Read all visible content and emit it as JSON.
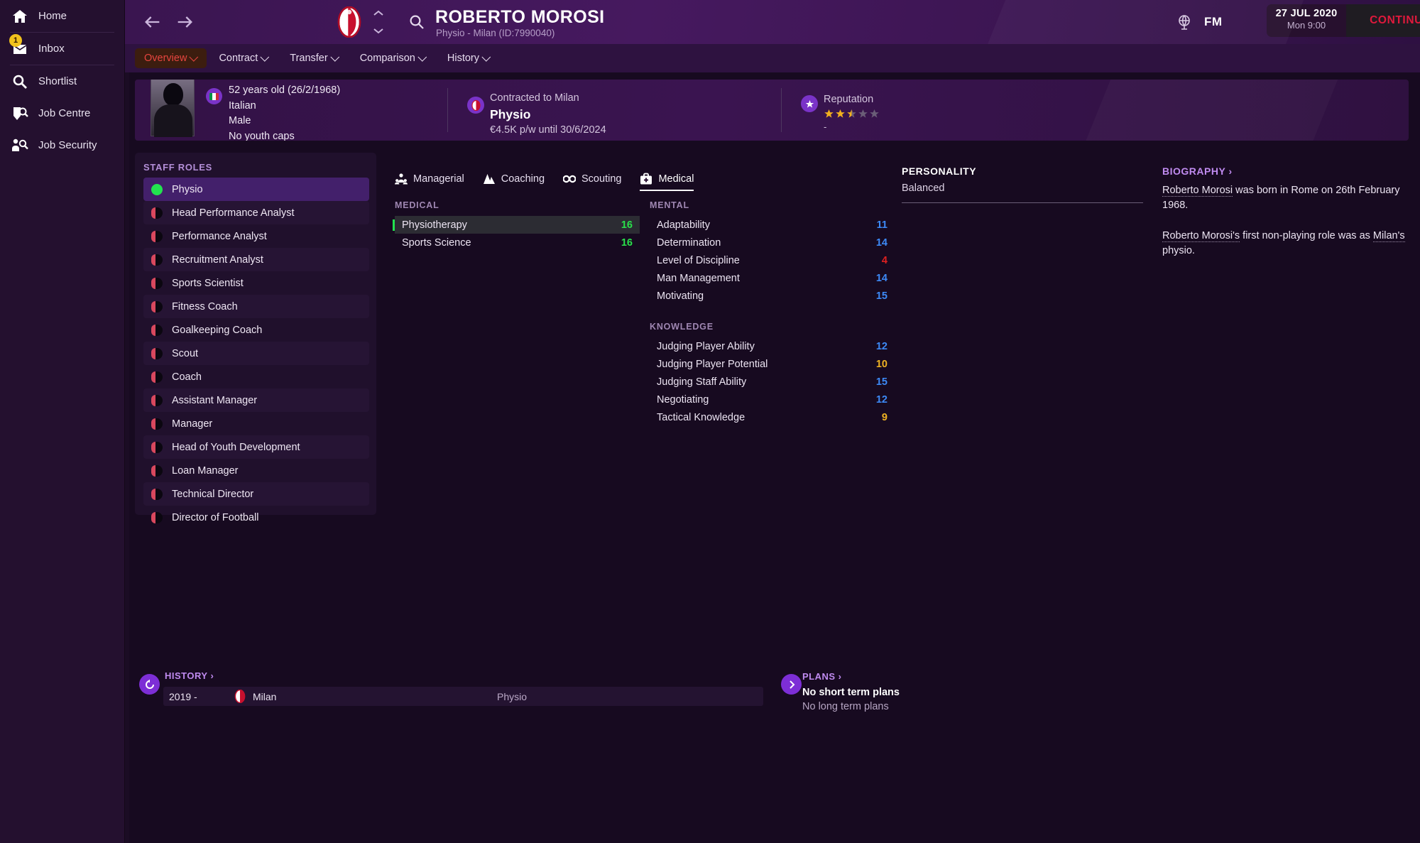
{
  "nav": {
    "items": [
      {
        "label": "Home",
        "icon": "home-icon",
        "badge": null
      },
      {
        "label": "Inbox",
        "icon": "inbox-icon",
        "badge": "1"
      },
      {
        "label": "Shortlist",
        "icon": "search-icon",
        "badge": null
      },
      {
        "label": "Job Centre",
        "icon": "job-centre-icon",
        "badge": null
      },
      {
        "label": "Job Security",
        "icon": "job-security-icon",
        "badge": null
      }
    ]
  },
  "topbar": {
    "back_icon": "back-arrow-icon",
    "forward_icon": "forward-arrow-icon",
    "club_crest": "ac-milan-crest-icon",
    "search_icon": "magnifier-icon",
    "person_name": "ROBERTO MOROSI",
    "person_sub": "Physio - Milan (ID:7990040)",
    "globe_icon": "globe-icon",
    "fm_logo": "FM",
    "date": "27 JUL 2020",
    "time": "Mon 9:00",
    "continue_label": "CONTINUE"
  },
  "submenu": {
    "items": [
      {
        "label": "Overview",
        "active": true
      },
      {
        "label": "Contract",
        "active": false
      },
      {
        "label": "Transfer",
        "active": false
      },
      {
        "label": "Comparison",
        "active": false
      },
      {
        "label": "History",
        "active": false
      }
    ]
  },
  "info": {
    "age": "52 years old (26/2/1968)",
    "nationality": "Italian",
    "gender": "Male",
    "caps": "No youth caps",
    "contract_label": "Contracted to Milan",
    "role": "Physio",
    "wage": "€4.5K p/w until 30/6/2024",
    "reputation_label": "Reputation",
    "reputation_stars": 2.5,
    "reputation_value": "-"
  },
  "staff_roles": {
    "title": "STAFF ROLES",
    "items": [
      {
        "label": "Physio",
        "selected": true,
        "status": "green"
      },
      {
        "label": "Head Performance Analyst",
        "selected": false,
        "status": "none"
      },
      {
        "label": "Performance Analyst",
        "selected": false,
        "status": "none"
      },
      {
        "label": "Recruitment Analyst",
        "selected": false,
        "status": "none"
      },
      {
        "label": "Sports Scientist",
        "selected": false,
        "status": "none"
      },
      {
        "label": "Fitness Coach",
        "selected": false,
        "status": "none"
      },
      {
        "label": "Goalkeeping Coach",
        "selected": false,
        "status": "none"
      },
      {
        "label": "Scout",
        "selected": false,
        "status": "none"
      },
      {
        "label": "Coach",
        "selected": false,
        "status": "none"
      },
      {
        "label": "Assistant Manager",
        "selected": false,
        "status": "none"
      },
      {
        "label": "Manager",
        "selected": false,
        "status": "none"
      },
      {
        "label": "Head of Youth Development",
        "selected": false,
        "status": "none"
      },
      {
        "label": "Loan Manager",
        "selected": false,
        "status": "none"
      },
      {
        "label": "Technical Director",
        "selected": false,
        "status": "none"
      },
      {
        "label": "Director of Football",
        "selected": false,
        "status": "none"
      }
    ]
  },
  "attribute_tabs": [
    {
      "label": "Managerial",
      "icon": "person-group-icon",
      "active": false
    },
    {
      "label": "Coaching",
      "icon": "whistle-cone-icon",
      "active": false
    },
    {
      "label": "Scouting",
      "icon": "binoculars-icon",
      "active": false
    },
    {
      "label": "Medical",
      "icon": "medical-bag-icon",
      "active": true
    }
  ],
  "attributes": {
    "medical": {
      "title": "MEDICAL",
      "rows": [
        {
          "name": "Physiotherapy",
          "value": "16",
          "color": "#29e04a",
          "highlight": true
        },
        {
          "name": "Sports Science",
          "value": "16",
          "color": "#29e04a",
          "highlight": false
        }
      ]
    },
    "mental": {
      "title": "MENTAL",
      "rows": [
        {
          "name": "Adaptability",
          "value": "11",
          "color": "#3d8af7"
        },
        {
          "name": "Determination",
          "value": "14",
          "color": "#3d8af7"
        },
        {
          "name": "Level of Discipline",
          "value": "4",
          "color": "#e02020"
        },
        {
          "name": "Man Management",
          "value": "14",
          "color": "#3d8af7"
        },
        {
          "name": "Motivating",
          "value": "15",
          "color": "#3d8af7"
        }
      ]
    },
    "knowledge": {
      "title": "KNOWLEDGE",
      "rows": [
        {
          "name": "Judging Player Ability",
          "value": "12",
          "color": "#3d8af7"
        },
        {
          "name": "Judging Player Potential",
          "value": "10",
          "color": "#f0b323"
        },
        {
          "name": "Judging Staff Ability",
          "value": "15",
          "color": "#3d8af7"
        },
        {
          "name": "Negotiating",
          "value": "12",
          "color": "#3d8af7"
        },
        {
          "name": "Tactical Knowledge",
          "value": "9",
          "color": "#f0b323"
        }
      ]
    }
  },
  "personality": {
    "title": "PERSONALITY",
    "value": "Balanced"
  },
  "biography": {
    "title": "BIOGRAPHY",
    "paragraph1_name": "Roberto Morosi",
    "paragraph1_rest": " was born in Rome on 26th February 1968.",
    "paragraph2_name": "Roberto Morosi's",
    "paragraph2_mid": " first non-playing role was as ",
    "paragraph2_club": "Milan's",
    "paragraph2_end": " physio."
  },
  "history": {
    "title": "HISTORY",
    "rows": [
      {
        "years": "2019 -",
        "club": "Milan",
        "role": "Physio"
      }
    ]
  },
  "plans": {
    "title": "PLANS",
    "short_term": "No short term plans",
    "long_term": "No long term plans"
  }
}
